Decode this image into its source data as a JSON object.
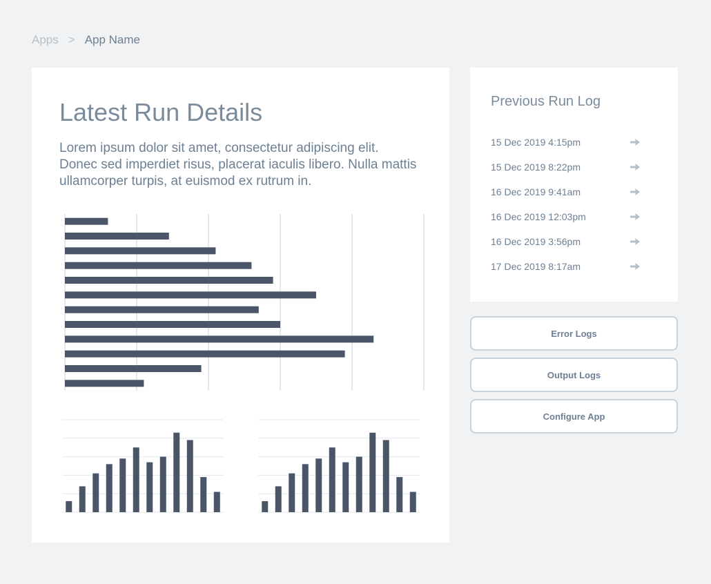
{
  "breadcrumb": {
    "root": "Apps",
    "separator": ">",
    "current": "App Name"
  },
  "main": {
    "title": "Latest Run Details",
    "description": "Lorem ipsum dolor sit amet, consectetur adipiscing elit. Donec sed imperdiet risus, placerat iaculis libero. Nulla mattis ullamcorper turpis, at euismod ex rutrum in."
  },
  "sidebar": {
    "title": "Previous Run Log",
    "logs": [
      {
        "label": "15 Dec 2019 4:15pm",
        "icon": "arrow-right-icon"
      },
      {
        "label": "15 Dec 2019 8:22pm",
        "icon": "arrow-right-icon"
      },
      {
        "label": "16 Dec 2019 9:41am",
        "icon": "arrow-right-icon"
      },
      {
        "label": "16 Dec 2019 12:03pm",
        "icon": "arrow-right-icon"
      },
      {
        "label": "16 Dec 2019 3:56pm",
        "icon": "arrow-right-icon"
      },
      {
        "label": "17 Dec 2019 8:17am",
        "icon": "arrow-right-icon"
      }
    ]
  },
  "actions": {
    "error_logs": "Error Logs",
    "output_logs": "Output Logs",
    "configure_app": "Configure App"
  },
  "colors": {
    "bar": "#4a5668",
    "grid": "#e4e7eb",
    "arrow": "#b6c0cb"
  },
  "chart_data": [
    {
      "type": "bar",
      "orientation": "horizontal",
      "values": [
        12,
        29,
        42,
        52,
        58,
        70,
        54,
        60,
        86,
        78,
        38,
        22
      ],
      "xlim": [
        0,
        100
      ],
      "grid": true
    },
    {
      "type": "bar",
      "values": [
        12,
        28,
        42,
        52,
        58,
        70,
        54,
        60,
        86,
        78,
        38,
        22
      ],
      "ylim": [
        0,
        100
      ],
      "grid": true
    },
    {
      "type": "bar",
      "values": [
        12,
        28,
        42,
        52,
        58,
        70,
        54,
        60,
        86,
        78,
        38,
        22
      ],
      "ylim": [
        0,
        100
      ],
      "grid": true
    }
  ]
}
